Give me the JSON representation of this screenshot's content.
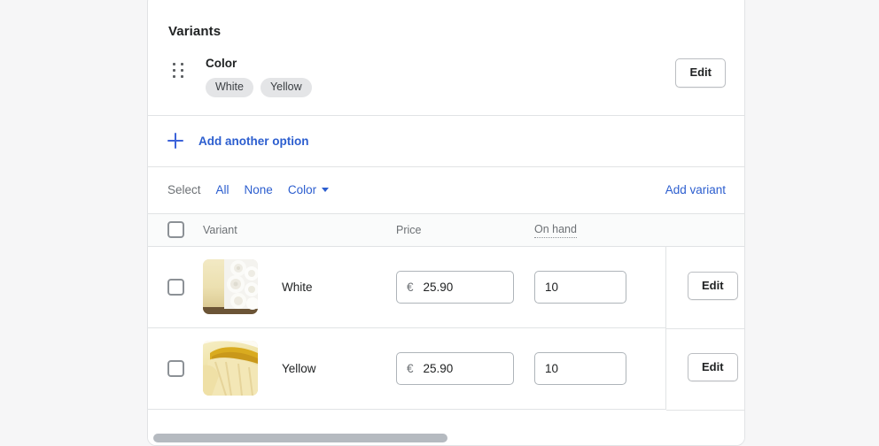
{
  "card": {
    "title": "Variants"
  },
  "option": {
    "drag_handle_icon": "drag-dots-icon",
    "name": "Color",
    "values": [
      "White",
      "Yellow"
    ],
    "edit_label": "Edit"
  },
  "add_option": {
    "icon": "plus-icon",
    "label": "Add another option"
  },
  "select_bar": {
    "label": "Select",
    "all_label": "All",
    "none_label": "None",
    "color_label": "Color",
    "caret_icon": "chevron-down-icon",
    "add_variant_label": "Add variant"
  },
  "table": {
    "headers": {
      "variant": "Variant",
      "price": "Price",
      "on_hand": "On hand"
    },
    "rows": [
      {
        "variant": "White",
        "currency": "€",
        "price": "25.90",
        "on_hand": "10",
        "edit_label": "Edit",
        "thumb_alt": "white-roses-thumbnail"
      },
      {
        "variant": "Yellow",
        "currency": "€",
        "price": "25.90",
        "on_hand": "10",
        "edit_label": "Edit",
        "thumb_alt": "yellow-petal-thumbnail"
      }
    ]
  },
  "colors": {
    "link": "#2c5ecf",
    "border": "#e1e3e5",
    "text": "#202223",
    "subdued": "#6d7175",
    "pill_bg": "#e4e5e7",
    "header_bg": "#fafbfb",
    "scrollbar": "#b5bac0"
  }
}
